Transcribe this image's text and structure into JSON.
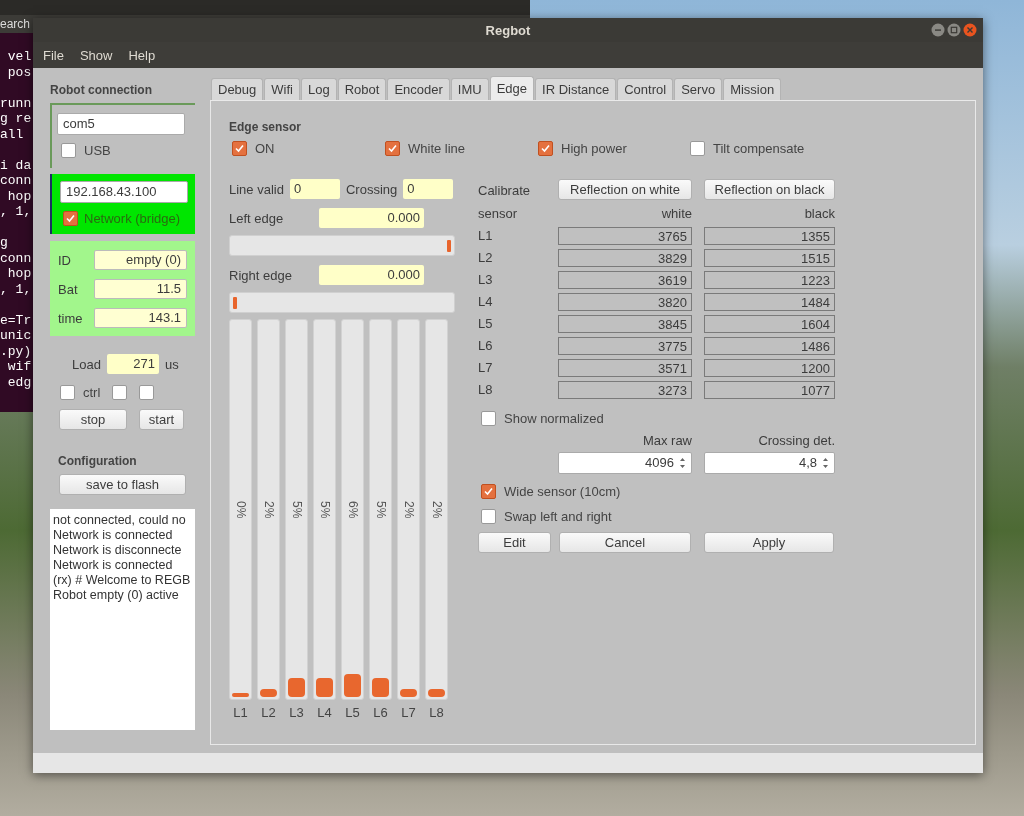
{
  "desktop": {
    "terminal": {
      "menu": "earch",
      "blocks": [
        [
          " vel",
          " pos"
        ],
        [
          "runn",
          "g re",
          "all "
        ],
        [
          "i da",
          "conn",
          " hop",
          ", 1,"
        ],
        [
          "g",
          "conn",
          " hop",
          ", 1,"
        ],
        [
          "e=Tr",
          "unic",
          ".py)",
          " wif",
          " edg"
        ]
      ]
    }
  },
  "window": {
    "title": "Regbot"
  },
  "menu": [
    "File",
    "Show",
    "Help"
  ],
  "connection": {
    "title": "Robot connection",
    "port": "com5",
    "usb": {
      "label": "USB",
      "checked": false
    },
    "address": "192.168.43.100",
    "network": {
      "label": "Network (bridge)",
      "checked": true
    },
    "info": [
      {
        "label": "ID",
        "value": "empty (0)"
      },
      {
        "label": "Bat",
        "value": "11.5"
      },
      {
        "label": "time",
        "value": "143.1"
      }
    ],
    "load": {
      "label": "Load",
      "value": "271",
      "unit": "us"
    },
    "options": [
      {
        "label": "ctrl",
        "checked": false
      },
      {
        "checked": false
      },
      {
        "checked": false
      }
    ],
    "buttons": [
      "stop",
      "start"
    ]
  },
  "configuration": {
    "title": "Configuration",
    "button": "save  to flash"
  },
  "log": [
    "not connected, could no",
    "Network is connected",
    "Network is disconnecte",
    "Network is connected",
    "(rx) # Welcome to REGB",
    "Robot empty (0) active"
  ],
  "tabs": [
    {
      "label": "Debug",
      "selected": false
    },
    {
      "label": "Wifi",
      "selected": false
    },
    {
      "label": "Log",
      "selected": false
    },
    {
      "label": "Robot",
      "selected": false
    },
    {
      "label": "Encoder",
      "selected": false
    },
    {
      "label": "IMU",
      "selected": false
    },
    {
      "label": "Edge",
      "selected": true
    },
    {
      "label": "IR Distance",
      "selected": false
    },
    {
      "label": "Control",
      "selected": false
    },
    {
      "label": "Servo",
      "selected": false
    },
    {
      "label": "Mission",
      "selected": false
    }
  ],
  "edge": {
    "title": "Edge sensor",
    "toggles": [
      {
        "label": "ON",
        "checked": true
      },
      {
        "label": "White line",
        "checked": true
      },
      {
        "label": "High power",
        "checked": true
      },
      {
        "label": "Tilt compensate",
        "checked": false
      }
    ],
    "line_valid": {
      "label": "Line valid",
      "value": "0"
    },
    "crossing": {
      "label": "Crossing",
      "value": "0"
    },
    "left_edge": {
      "label": "Left edge",
      "value": "0.000",
      "level": 1
    },
    "right_edge": {
      "label": "Right edge",
      "value": "0.000",
      "level": 0
    },
    "bars": [
      {
        "label": "L1",
        "reading": "0%",
        "level": 0
      },
      {
        "label": "L2",
        "reading": "2%",
        "level": 0.02
      },
      {
        "label": "L3",
        "reading": "5%",
        "level": 0.05
      },
      {
        "label": "L4",
        "reading": "5%",
        "level": 0.05
      },
      {
        "label": "L5",
        "reading": "6%",
        "level": 0.06
      },
      {
        "label": "L6",
        "reading": "5%",
        "level": 0.05
      },
      {
        "label": "L7",
        "reading": "2%",
        "level": 0.02
      },
      {
        "label": "L8",
        "reading": "2%",
        "level": 0.02
      }
    ],
    "calibrate": {
      "label": "Calibrate",
      "buttons": [
        "Reflection on white",
        "Reflection on black"
      ]
    },
    "columns": [
      "sensor",
      "white",
      "black"
    ],
    "rows": [
      {
        "sensor": "L1",
        "white": "3765",
        "black": "1355"
      },
      {
        "sensor": "L2",
        "white": "3829",
        "black": "1515"
      },
      {
        "sensor": "L3",
        "white": "3619",
        "black": "1223"
      },
      {
        "sensor": "L4",
        "white": "3820",
        "black": "1484"
      },
      {
        "sensor": "L5",
        "white": "3845",
        "black": "1604"
      },
      {
        "sensor": "L6",
        "white": "3775",
        "black": "1486"
      },
      {
        "sensor": "L7",
        "white": "3571",
        "black": "1200"
      },
      {
        "sensor": "L8",
        "white": "3273",
        "black": "1077"
      }
    ],
    "show_normalized": {
      "label": "Show normalized",
      "checked": false
    },
    "max_raw": {
      "label": "Max raw",
      "value": "4096"
    },
    "crossing_det": {
      "label": "Crossing det.",
      "value": "4,8"
    },
    "wide_sensor": {
      "label": "Wide sensor (10cm)",
      "checked": true
    },
    "swap": {
      "label": "Swap left and right",
      "checked": false
    },
    "buttons": [
      "Edit",
      "Cancel",
      "Apply"
    ]
  }
}
